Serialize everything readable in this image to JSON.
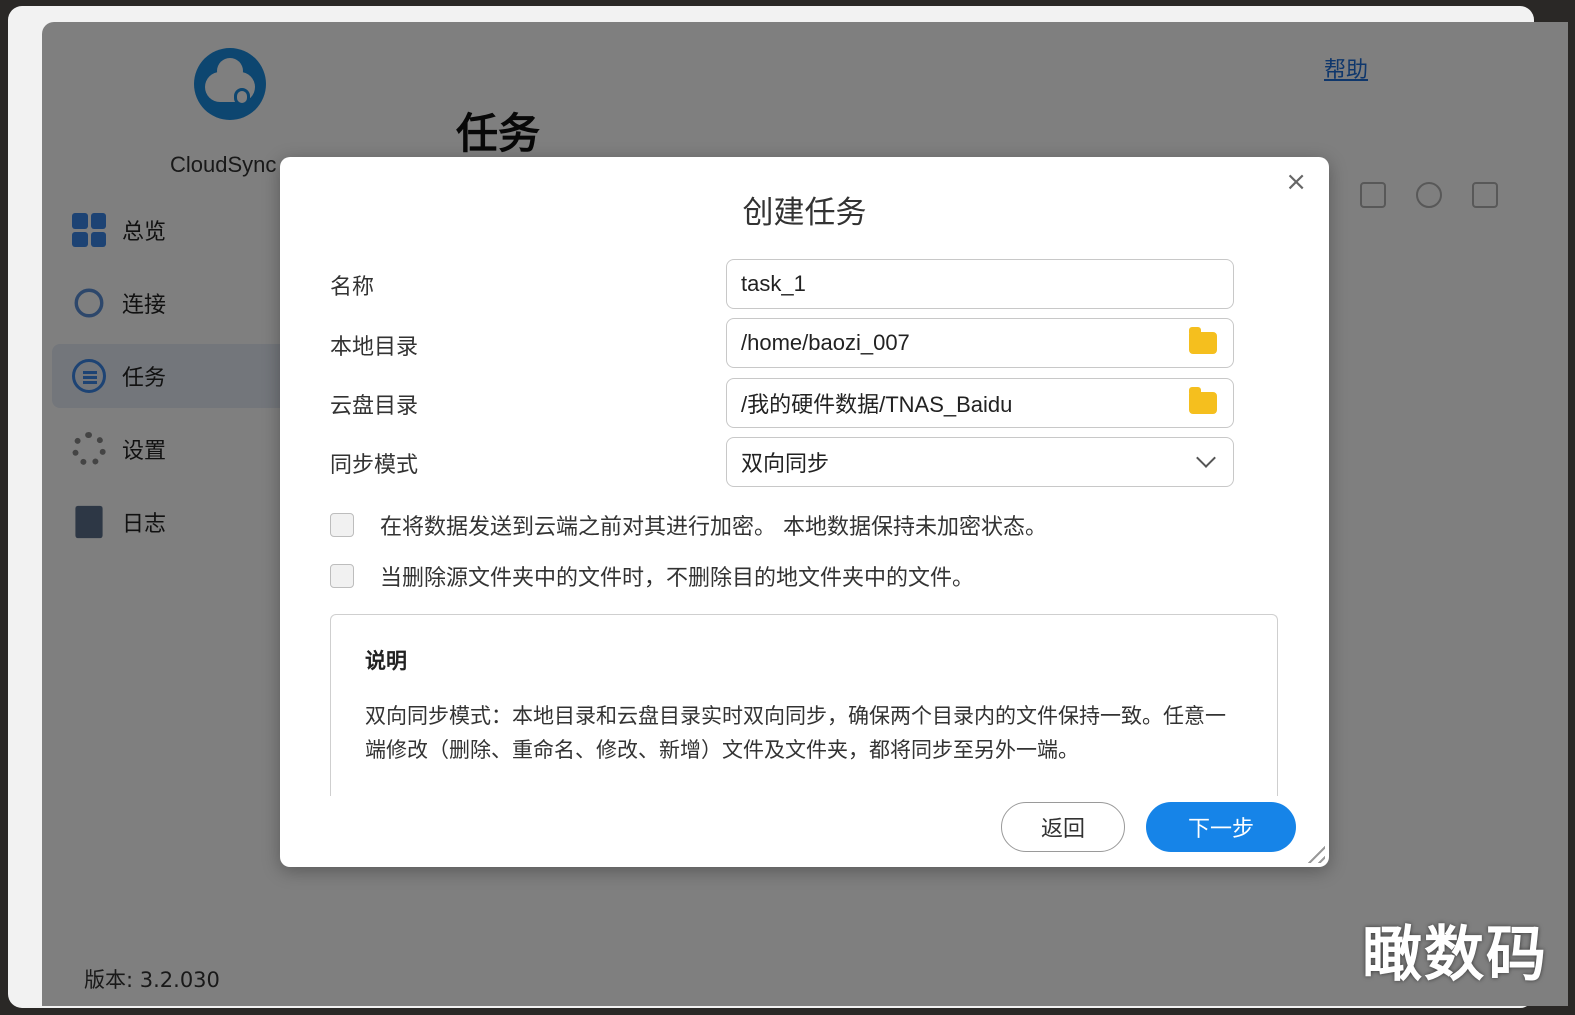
{
  "app": {
    "name": "CloudSync",
    "help_label": "帮助",
    "page_title": "任务",
    "version_label": "版本: 3.2.030"
  },
  "sidebar": {
    "items": [
      {
        "label": "总览",
        "icon": "overview-icon"
      },
      {
        "label": "连接",
        "icon": "link-icon"
      },
      {
        "label": "任务",
        "icon": "task-icon",
        "active": true
      },
      {
        "label": "设置",
        "icon": "gear-icon"
      },
      {
        "label": "日志",
        "icon": "log-icon"
      }
    ]
  },
  "toolbar": {
    "icons": [
      "edit-icon",
      "check-circle-icon",
      "trash-icon"
    ]
  },
  "dialog": {
    "title": "创建任务",
    "close_glyph": "×",
    "fields": {
      "name": {
        "label": "名称",
        "value": "task_1"
      },
      "local_dir": {
        "label": "本地目录",
        "value": "/home/baozi_007",
        "icon": "folder-icon"
      },
      "cloud_dir": {
        "label": "云盘目录",
        "value": "/我的硬件数据/TNAS_Baidu",
        "icon": "folder-icon"
      },
      "sync_mode": {
        "label": "同步模式",
        "value": "双向同步",
        "icon": "chevron-down-icon"
      }
    },
    "checkboxes": {
      "encrypt": {
        "label": "在将数据发送到云端之前对其进行加密。 本地数据保持未加密状态。",
        "checked": false
      },
      "keep_on_delete": {
        "label": "当删除源文件夹中的文件时，不删除目的地文件夹中的文件。",
        "checked": false
      }
    },
    "description": {
      "title": "说明",
      "text": "双向同步模式：本地目录和云盘目录实时双向同步，确保两个目录内的文件保持一致。任意一端修改（删除、重命名、修改、新增）文件及文件夹，都将同步至另外一端。"
    },
    "buttons": {
      "back": "返回",
      "next": "下一步"
    }
  },
  "watermark": "瞰数码",
  "colors": {
    "accent": "#1684e8",
    "folder": "#f5bf1e",
    "overlay": "rgba(0,0,0,0.5)"
  }
}
